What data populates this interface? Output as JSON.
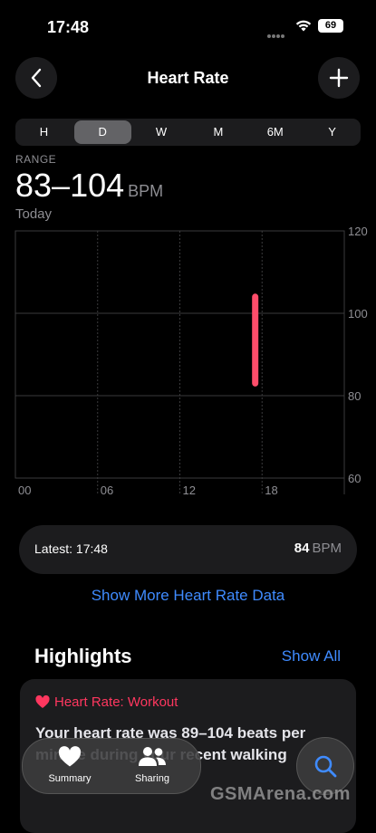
{
  "status_bar": {
    "time": "17:48",
    "battery": "69"
  },
  "header": {
    "title": "Heart Rate"
  },
  "segments": [
    "H",
    "D",
    "W",
    "M",
    "6M",
    "Y"
  ],
  "segment_active": "D",
  "summary": {
    "label": "RANGE",
    "value": "83–104",
    "unit": "BPM",
    "date": "Today"
  },
  "chart_data": {
    "type": "bar",
    "title": "",
    "x_ticks": [
      "00",
      "06",
      "12",
      "18"
    ],
    "y_ticks": [
      "120",
      "100",
      "80",
      "60"
    ],
    "ylim": [
      60,
      120
    ],
    "series": [
      {
        "values": [
          {
            "x": "17:00",
            "low": 83,
            "high": 104
          }
        ]
      }
    ],
    "colors": {
      "bar": "#ff4d6a",
      "grid": "#3a3a3c"
    }
  },
  "latest": {
    "label": "Latest: 17:48",
    "value": "84",
    "unit": "BPM"
  },
  "more_link": "Show More Heart Rate Data",
  "highlights": {
    "heading": "Highlights",
    "show_all": "Show All",
    "card_title": "Heart Rate: Workout",
    "card_body": "Your heart rate was 89–104 beats per minute during your recent walking"
  },
  "tabbar": {
    "summary": "Summary",
    "sharing": "Sharing"
  },
  "watermark": "GSMArena.com",
  "icons": {
    "back": "chevron-left-icon",
    "add": "plus-icon",
    "summary": "heart-icon",
    "sharing": "people-icon",
    "search": "search-icon"
  }
}
